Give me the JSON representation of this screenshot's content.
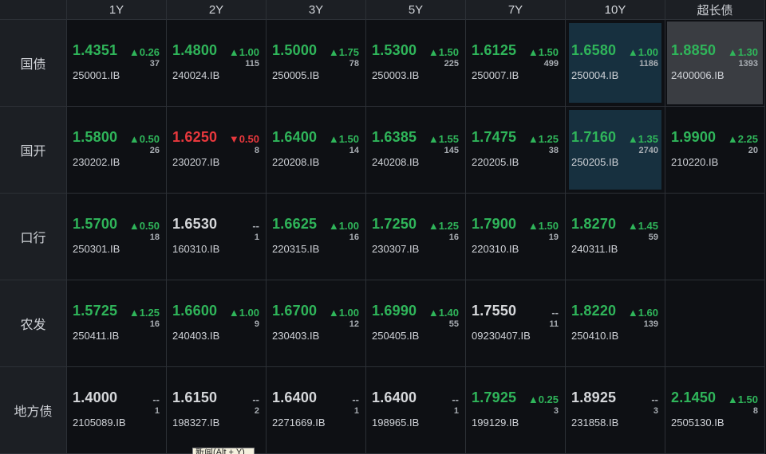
{
  "columns": [
    "1Y",
    "2Y",
    "3Y",
    "5Y",
    "7Y",
    "10Y",
    "超长债"
  ],
  "rows": [
    {
      "label": "国债",
      "cells": [
        {
          "rate": "1.4351",
          "change": "▲0.26",
          "volume": "37",
          "code": "250001.IB",
          "trend": "up"
        },
        {
          "rate": "1.4800",
          "change": "▲1.00",
          "volume": "115",
          "code": "240024.IB",
          "trend": "up"
        },
        {
          "rate": "1.5000",
          "change": "▲1.75",
          "volume": "78",
          "code": "250005.IB",
          "trend": "up"
        },
        {
          "rate": "1.5300",
          "change": "▲1.50",
          "volume": "225",
          "code": "250003.IB",
          "trend": "up"
        },
        {
          "rate": "1.6125",
          "change": "▲1.50",
          "volume": "499",
          "code": "250007.IB",
          "trend": "up"
        },
        {
          "rate": "1.6580",
          "change": "▲1.00",
          "volume": "1186",
          "code": "250004.IB",
          "trend": "up",
          "highlight": "blue"
        },
        {
          "rate": "1.8850",
          "change": "▲1.30",
          "volume": "1393",
          "code": "2400006.IB",
          "trend": "up",
          "highlight": "gray"
        }
      ]
    },
    {
      "label": "国开",
      "cells": [
        {
          "rate": "1.5800",
          "change": "▲0.50",
          "volume": "26",
          "code": "230202.IB",
          "trend": "up"
        },
        {
          "rate": "1.6250",
          "change": "▼0.50",
          "volume": "8",
          "code": "230207.IB",
          "trend": "down"
        },
        {
          "rate": "1.6400",
          "change": "▲1.50",
          "volume": "14",
          "code": "220208.IB",
          "trend": "up"
        },
        {
          "rate": "1.6385",
          "change": "▲1.55",
          "volume": "145",
          "code": "240208.IB",
          "trend": "up"
        },
        {
          "rate": "1.7475",
          "change": "▲1.25",
          "volume": "38",
          "code": "220205.IB",
          "trend": "up"
        },
        {
          "rate": "1.7160",
          "change": "▲1.35",
          "volume": "2740",
          "code": "250205.IB",
          "trend": "up",
          "highlight": "blue"
        },
        {
          "rate": "1.9900",
          "change": "▲2.25",
          "volume": "20",
          "code": "210220.IB",
          "trend": "up"
        }
      ]
    },
    {
      "label": "口行",
      "cells": [
        {
          "rate": "1.5700",
          "change": "▲0.50",
          "volume": "18",
          "code": "250301.IB",
          "trend": "up"
        },
        {
          "rate": "1.6530",
          "change": "--",
          "volume": "1",
          "code": "160310.IB",
          "trend": "flat"
        },
        {
          "rate": "1.6625",
          "change": "▲1.00",
          "volume": "16",
          "code": "220315.IB",
          "trend": "up"
        },
        {
          "rate": "1.7250",
          "change": "▲1.25",
          "volume": "16",
          "code": "230307.IB",
          "trend": "up"
        },
        {
          "rate": "1.7900",
          "change": "▲1.50",
          "volume": "19",
          "code": "220310.IB",
          "trend": "up"
        },
        {
          "rate": "1.8270",
          "change": "▲1.45",
          "volume": "59",
          "code": "240311.IB",
          "trend": "up"
        },
        null
      ]
    },
    {
      "label": "农发",
      "cells": [
        {
          "rate": "1.5725",
          "change": "▲1.25",
          "volume": "16",
          "code": "250411.IB",
          "trend": "up"
        },
        {
          "rate": "1.6600",
          "change": "▲1.00",
          "volume": "9",
          "code": "240403.IB",
          "trend": "up"
        },
        {
          "rate": "1.6700",
          "change": "▲1.00",
          "volume": "12",
          "code": "230403.IB",
          "trend": "up"
        },
        {
          "rate": "1.6990",
          "change": "▲1.40",
          "volume": "55",
          "code": "250405.IB",
          "trend": "up"
        },
        {
          "rate": "1.7550",
          "change": "--",
          "volume": "11",
          "code": "09230407.IB",
          "trend": "flat"
        },
        {
          "rate": "1.8220",
          "change": "▲1.60",
          "volume": "139",
          "code": "250410.IB",
          "trend": "up"
        },
        null
      ]
    },
    {
      "label": "地方债",
      "cells": [
        {
          "rate": "1.4000",
          "change": "--",
          "volume": "1",
          "code": "2105089.IB",
          "trend": "flat"
        },
        {
          "rate": "1.6150",
          "change": "--",
          "volume": "2",
          "code": "198327.IB",
          "trend": "flat"
        },
        {
          "rate": "1.6400",
          "change": "--",
          "volume": "1",
          "code": "2271669.IB",
          "trend": "flat"
        },
        {
          "rate": "1.6400",
          "change": "--",
          "volume": "1",
          "code": "198965.IB",
          "trend": "flat"
        },
        {
          "rate": "1.7925",
          "change": "▲0.25",
          "volume": "3",
          "code": "199129.IB",
          "trend": "up"
        },
        {
          "rate": "1.8925",
          "change": "--",
          "volume": "3",
          "code": "231858.IB",
          "trend": "flat"
        },
        {
          "rate": "2.1450",
          "change": "▲1.50",
          "volume": "8",
          "code": "2505130.IB",
          "trend": "up"
        }
      ]
    }
  ],
  "tooltip": {
    "text": "新闻(Alt + Y)"
  },
  "colors": {
    "up": "#2fb55a",
    "down": "#e8383d",
    "flat": "#d6d8db",
    "highlight_blue": "#17303f",
    "highlight_gray": "#3a3d42",
    "background": "#0e1014",
    "header_bg": "#1c1f24"
  }
}
